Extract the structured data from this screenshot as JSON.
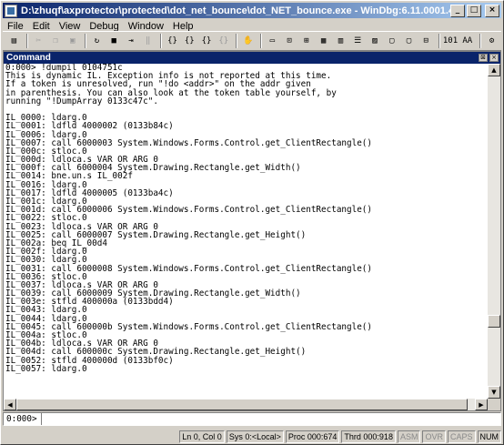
{
  "window": {
    "title": "D:\\zhuqf\\axprotector\\protected\\dot_net_bounce\\dot_NET_bounce.exe - WinDbg:6.11.0001.404 X86",
    "minimize_glyph": "_",
    "maximize_glyph": "□",
    "close_glyph": "×"
  },
  "menu": {
    "items": [
      {
        "label": "File"
      },
      {
        "label": "Edit"
      },
      {
        "label": "View"
      },
      {
        "label": "Debug"
      },
      {
        "label": "Window"
      },
      {
        "label": "Help"
      }
    ]
  },
  "toolbar": {
    "buttons": [
      {
        "name": "open-icon",
        "glyph": "▤"
      },
      {
        "name": "cut-icon",
        "glyph": "✂"
      },
      {
        "name": "copy-icon",
        "glyph": "❐"
      },
      {
        "name": "paste-icon",
        "glyph": "▣"
      },
      {
        "name": "restart-icon",
        "glyph": "↻"
      },
      {
        "name": "stop-debugging-icon",
        "glyph": "■"
      },
      {
        "name": "detach-icon",
        "glyph": "⇥"
      },
      {
        "name": "break-icon",
        "glyph": "‖"
      },
      {
        "name": "step-into-icon",
        "glyph": "{}"
      },
      {
        "name": "step-over-icon",
        "glyph": "{}"
      },
      {
        "name": "step-out-icon",
        "glyph": "{}"
      },
      {
        "name": "run-to-cursor-icon",
        "glyph": "{}"
      },
      {
        "name": "hand-icon",
        "glyph": "✋"
      },
      {
        "name": "command-window-icon",
        "glyph": "▭"
      },
      {
        "name": "watch-icon",
        "glyph": "⊡"
      },
      {
        "name": "locals-icon",
        "glyph": "⊞"
      },
      {
        "name": "registers-icon",
        "glyph": "▦"
      },
      {
        "name": "memory-icon",
        "glyph": "▥"
      },
      {
        "name": "call-stack-icon",
        "glyph": "☰"
      },
      {
        "name": "disassembly-icon",
        "glyph": "▨"
      },
      {
        "name": "scratch-pad-icon",
        "glyph": "▢"
      },
      {
        "name": "processes-icon",
        "glyph": "▢"
      },
      {
        "name": "source-mode-icon",
        "glyph": "⊟"
      },
      {
        "name": "hex-display-icon",
        "glyph": "101"
      },
      {
        "name": "font-icon",
        "glyph": "AA"
      },
      {
        "name": "options-icon",
        "glyph": "⚙"
      }
    ]
  },
  "command_pane": {
    "title": "Command",
    "lines": [
      "0:000> !dumpil 0104751c",
      "This is dynamic IL. Exception info is not reported at this time.",
      "If a token is unresolved, run \"!do <addr>\" on the addr given",
      "in parenthesis. You can also look at the token table yourself, by",
      "running \"!DumpArray 0133c47c\".",
      "",
      "IL_0000: ldarg.0",
      "IL_0001: ldfld 4000002 (0133b84c)",
      "IL_0006: ldarg.0",
      "IL_0007: call 6000003 System.Windows.Forms.Control.get_ClientRectangle()",
      "IL_000c: stloc.0",
      "IL_000d: ldloca.s VAR OR ARG 0",
      "IL_000f: call 6000004 System.Drawing.Rectangle.get_Width()",
      "IL_0014: bne.un.s IL_002f",
      "IL_0016: ldarg.0",
      "IL_0017: ldfld 4000005 (0133ba4c)",
      "IL_001c: ldarg.0",
      "IL_001d: call 6000006 System.Windows.Forms.Control.get_ClientRectangle()",
      "IL_0022: stloc.0",
      "IL_0023: ldloca.s VAR OR ARG 0",
      "IL_0025: call 6000007 System.Drawing.Rectangle.get_Height()",
      "IL_002a: beq IL_00d4",
      "IL_002f: ldarg.0",
      "IL_0030: ldarg.0",
      "IL_0031: call 6000008 System.Windows.Forms.Control.get_ClientRectangle()",
      "IL_0036: stloc.0",
      "IL_0037: ldloca.s VAR OR ARG 0",
      "IL_0039: call 6000009 System.Drawing.Rectangle.get_Width()",
      "IL_003e: stfld 400000a (0133bdd4)",
      "IL_0043: ldarg.0",
      "IL_0044: ldarg.0",
      "IL_0045: call 600000b System.Windows.Forms.Control.get_ClientRectangle()",
      "IL_004a: stloc.0",
      "IL_004b: ldloca.s VAR OR ARG 0",
      "IL_004d: call 600000c System.Drawing.Rectangle.get_Height()",
      "IL_0052: stfld 400000d (0133bf0c)",
      "IL_0057: ldarg.0"
    ],
    "scroll_up_glyph": "▲",
    "scroll_down_glyph": "▼",
    "scroll_left_glyph": "◀",
    "scroll_right_glyph": "▶",
    "pane_buttons": [
      "⊠",
      "×"
    ]
  },
  "command_input": {
    "prompt": "0:000>",
    "value": ""
  },
  "status": {
    "ln_col": "Ln 0, Col 0",
    "sys": "Sys 0:<Local>",
    "proc": "Proc 000:674",
    "thrd": "Thrd 000:918",
    "asm": "ASM",
    "ovr": "OVR",
    "caps": "CAPS",
    "num": "NUM"
  }
}
